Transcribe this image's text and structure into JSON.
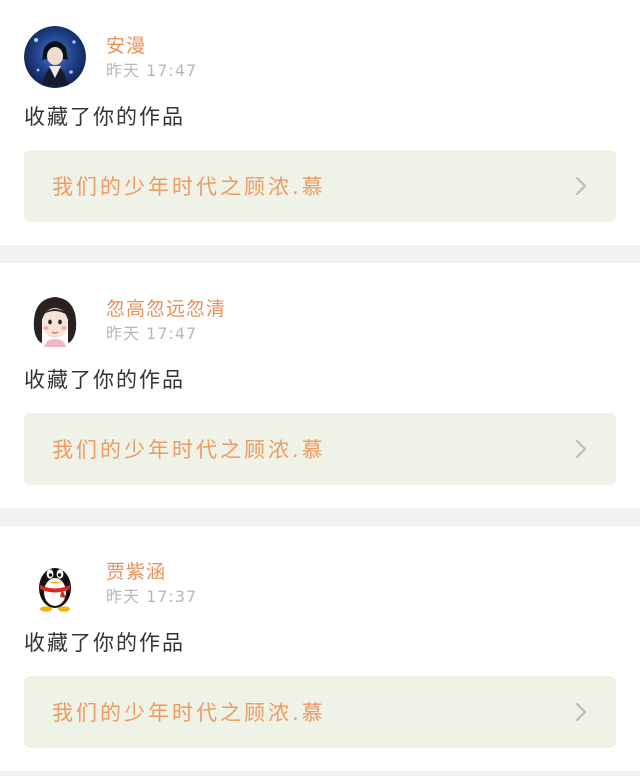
{
  "notifications": [
    {
      "username": "安漫",
      "time": "昨天 17:47",
      "action": "收藏了你的作品",
      "work_title": "我们的少年时代之顾浓.慕",
      "avatar_icon": "anime-avatar-icon"
    },
    {
      "username": "忽高忽远忽清",
      "time": "昨天 17:47",
      "action": "收藏了你的作品",
      "work_title": "我们的少年时代之顾浓.慕",
      "avatar_icon": "girl-avatar-icon"
    },
    {
      "username": "贾紫涵",
      "time": "昨天 17:37",
      "action": "收藏了你的作品",
      "work_title": "我们的少年时代之顾浓.慕",
      "avatar_icon": "qq-penguin-avatar-icon"
    }
  ],
  "colors": {
    "username": "#e8905a",
    "work_title": "#ee9a62",
    "work_bg": "#eff2e6",
    "timestamp": "#b8b8b8",
    "separator": "#f2f2f2"
  }
}
